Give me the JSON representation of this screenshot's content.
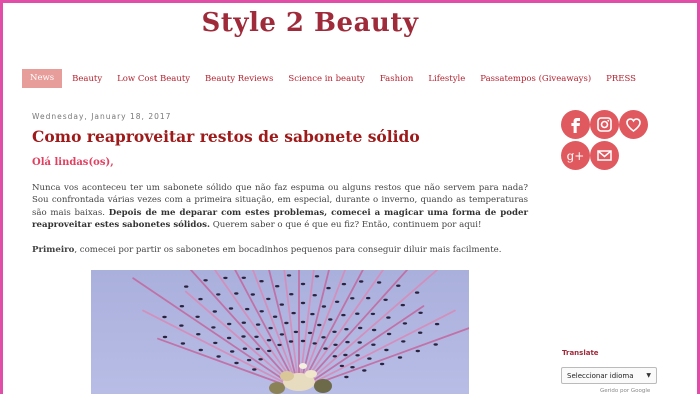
{
  "blog": {
    "title": "Style 2 Beauty"
  },
  "nav": {
    "items": [
      {
        "label": "News",
        "active": true
      },
      {
        "label": "Beauty"
      },
      {
        "label": "Low Cost Beauty"
      },
      {
        "label": "Beauty Reviews"
      },
      {
        "label": "Science in beauty"
      },
      {
        "label": "Fashion"
      },
      {
        "label": "Lifestyle"
      },
      {
        "label": "Passatempos (Giveaways)"
      },
      {
        "label": "PRESS"
      }
    ]
  },
  "post": {
    "date": "Wednesday, January 18, 2017",
    "title": "Como reaproveitar restos de sabonete sólido",
    "greeting": "Olá lindas(os),",
    "p1_a": "Nunca vos aconteceu ter um sabonete sólido que não faz espuma ou alguns restos que não servem para nada? Sou confrontada várias vezes com a primeira situação, em especial, durante o inverno, quando as temperaturas são mais baixas. ",
    "p1_b": "Depois de me deparar com estes problemas, comecei a magicar uma forma de poder reaproveitar estes sabonetes sólidos.",
    "p1_c": " Querem saber o que é que eu fiz? Então, continuem por aqui!",
    "p2_a": "Primeiro",
    "p2_b": ", comecei por partir os sabonetes em bocadinhos pequenos para conseguir diluir mais facilmente."
  },
  "social": {
    "icons": [
      "facebook-icon",
      "instagram-icon",
      "heart-icon",
      "google-plus-icon",
      "email-icon"
    ],
    "color": "#e0595f"
  },
  "sidebar": {
    "translate_title": "Translate",
    "language_select": "Seleccionar idioma",
    "powered_text": "Gerido por Google"
  },
  "colors": {
    "brand": "#9e2a3a",
    "accent": "#e79d9a",
    "frame": "#e04ea8"
  }
}
